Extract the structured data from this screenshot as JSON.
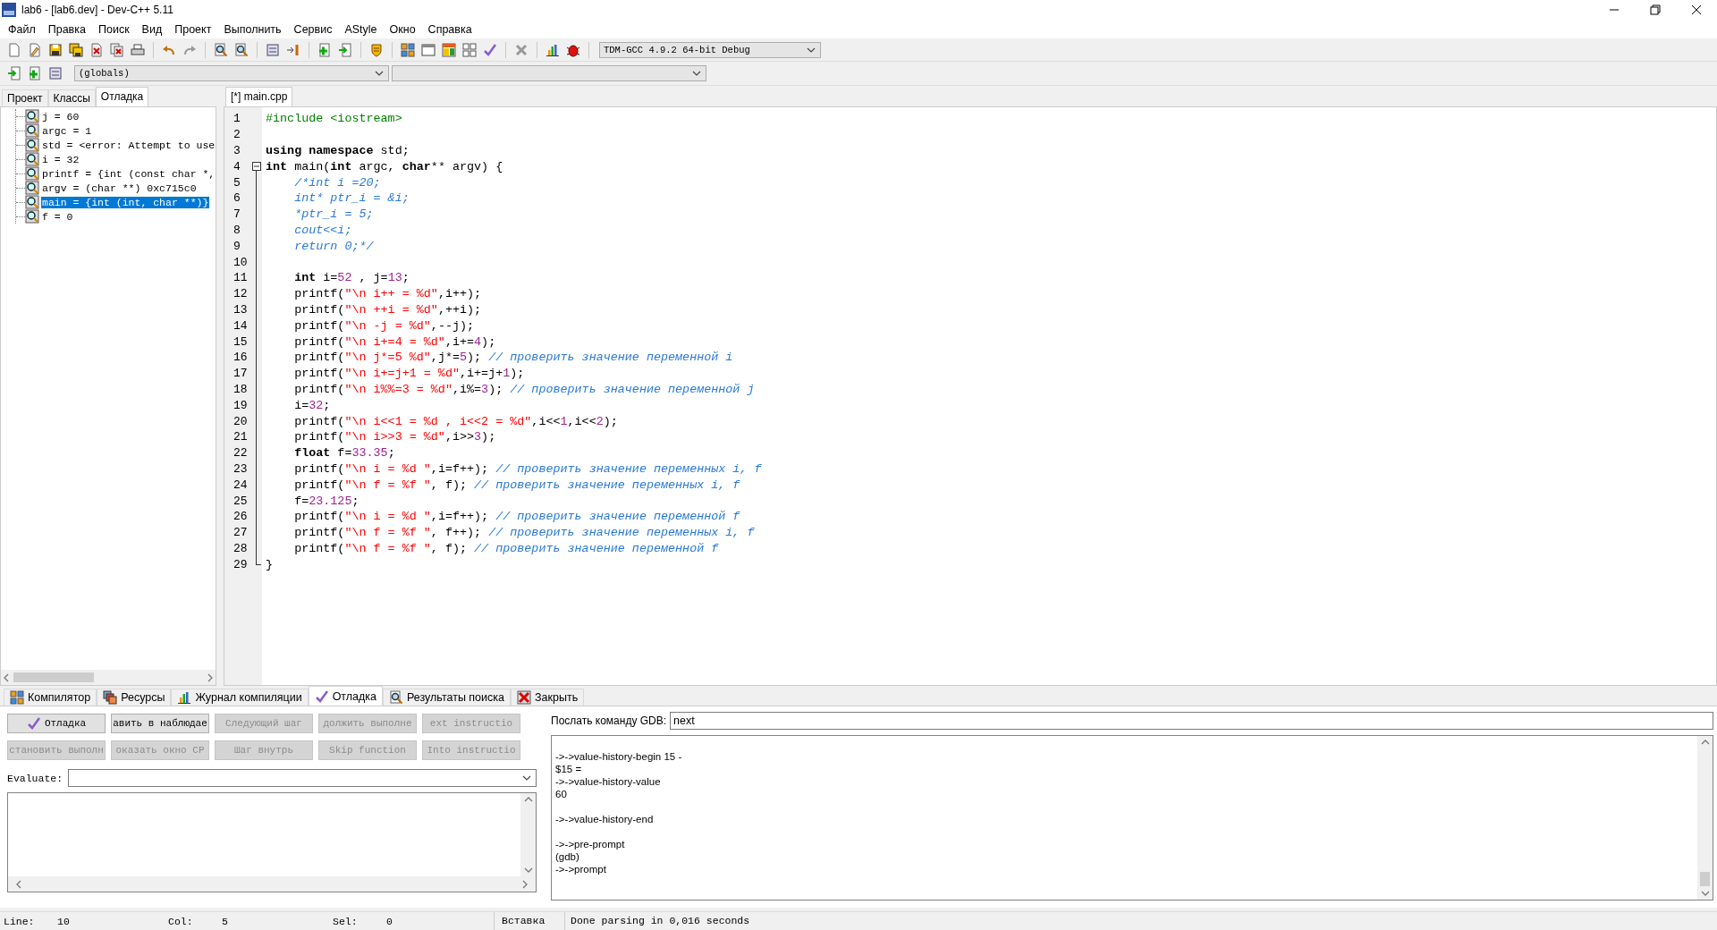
{
  "window": {
    "title": "lab6 - [lab6.dev] - Dev-C++ 5.11"
  },
  "menu": [
    "Файл",
    "Правка",
    "Поиск",
    "Вид",
    "Проект",
    "Выполнить",
    "Сервис",
    "AStyle",
    "Окно",
    "Справка"
  ],
  "toolbar": {
    "compiler": "TDM-GCC 4.9.2 64-bit Debug",
    "scope": "(globals)"
  },
  "left_panel": {
    "tabs": [
      {
        "label": "Проект",
        "selected": false
      },
      {
        "label": "Классы",
        "selected": false
      },
      {
        "label": "Отладка",
        "selected": true
      }
    ],
    "watches": [
      {
        "text": "j = 60",
        "selected": false
      },
      {
        "text": "argc = 1",
        "selected": false
      },
      {
        "text": "std = <error: Attempt to use",
        "selected": false
      },
      {
        "text": "i = 32",
        "selected": false
      },
      {
        "text": "printf = {int (const char *,",
        "selected": false
      },
      {
        "text": "argv = (char **) 0xc715c0",
        "selected": false
      },
      {
        "text": "main = {int (int, char **)}",
        "selected": true
      },
      {
        "text": "f = 0",
        "selected": false
      }
    ]
  },
  "editor": {
    "tabs": [
      {
        "label": "[*] main.cpp",
        "selected": true
      }
    ],
    "lines": [
      {
        "number": "1",
        "kind": "plain",
        "tokens": [
          {
            "kind": "pre",
            "text": "#include <iostream>"
          }
        ]
      },
      {
        "number": "2",
        "kind": "plain"
      },
      {
        "number": "3",
        "kind": "plain",
        "tokens": [
          {
            "kind": "kw",
            "text": "using namespace"
          },
          {
            "kind": "txt",
            "text": " std;"
          }
        ]
      },
      {
        "number": "4",
        "kind": "fold_start",
        "tokens": [
          {
            "kind": "kw",
            "text": "int"
          },
          {
            "kind": "txt",
            "text": " main("
          },
          {
            "kind": "kw",
            "text": "int"
          },
          {
            "kind": "txt",
            "text": " argc, "
          },
          {
            "kind": "kw",
            "text": "char"
          },
          {
            "kind": "txt",
            "text": "** argv) {"
          }
        ]
      },
      {
        "number": "5",
        "kind": "fold_body",
        "tokens": [
          {
            "kind": "com",
            "text": "    /*int i =20;"
          }
        ]
      },
      {
        "number": "6",
        "kind": "fold_body",
        "tokens": [
          {
            "kind": "com",
            "text": "    int* ptr_i = &i;"
          }
        ]
      },
      {
        "number": "7",
        "kind": "fold_body",
        "tokens": [
          {
            "kind": "com",
            "text": "    *ptr_i = 5;"
          }
        ]
      },
      {
        "number": "8",
        "kind": "fold_body",
        "tokens": [
          {
            "kind": "com",
            "text": "    cout<<i;"
          }
        ]
      },
      {
        "number": "9",
        "kind": "fold_body",
        "tokens": [
          {
            "kind": "com",
            "text": "    return 0;*/"
          }
        ]
      },
      {
        "number": "10",
        "kind": "fold_body"
      },
      {
        "number": "11",
        "kind": "fold_body",
        "tokens": [
          {
            "kind": "kw",
            "text": "    int"
          },
          {
            "kind": "txt",
            "text": " i="
          },
          {
            "kind": "num",
            "text": "52"
          },
          {
            "kind": "txt",
            "text": " , j="
          },
          {
            "kind": "num",
            "text": "13"
          },
          {
            "kind": "txt",
            "text": ";"
          }
        ]
      },
      {
        "number": "12",
        "kind": "fold_body",
        "tokens": [
          {
            "kind": "txt",
            "text": "    printf("
          },
          {
            "kind": "str",
            "text": "\"\\n i++ = %d\""
          },
          {
            "kind": "txt",
            "text": ",i++);"
          }
        ]
      },
      {
        "number": "13",
        "kind": "fold_body",
        "tokens": [
          {
            "kind": "txt",
            "text": "    printf("
          },
          {
            "kind": "str",
            "text": "\"\\n ++i = %d\""
          },
          {
            "kind": "txt",
            "text": ",++i);"
          }
        ]
      },
      {
        "number": "14",
        "kind": "fold_body",
        "tokens": [
          {
            "kind": "txt",
            "text": "    printf("
          },
          {
            "kind": "str",
            "text": "\"\\n -j = %d\""
          },
          {
            "kind": "txt",
            "text": ",--j);"
          }
        ]
      },
      {
        "number": "15",
        "kind": "fold_body",
        "tokens": [
          {
            "kind": "txt",
            "text": "    printf("
          },
          {
            "kind": "str",
            "text": "\"\\n i+=4 = %d\""
          },
          {
            "kind": "txt",
            "text": ",i+="
          },
          {
            "kind": "num",
            "text": "4"
          },
          {
            "kind": "txt",
            "text": ");"
          }
        ]
      },
      {
        "number": "16",
        "kind": "fold_body",
        "tokens": [
          {
            "kind": "txt",
            "text": "    printf("
          },
          {
            "kind": "str",
            "text": "\"\\n j*=5 %d\""
          },
          {
            "kind": "txt",
            "text": ",j*="
          },
          {
            "kind": "num",
            "text": "5"
          },
          {
            "kind": "txt",
            "text": "); "
          },
          {
            "kind": "com",
            "text": "// проверить значение переменной i"
          }
        ]
      },
      {
        "number": "17",
        "kind": "fold_body",
        "tokens": [
          {
            "kind": "txt",
            "text": "    printf("
          },
          {
            "kind": "str",
            "text": "\"\\n i+=j+1 = %d\""
          },
          {
            "kind": "txt",
            "text": ",i+=j+"
          },
          {
            "kind": "num",
            "text": "1"
          },
          {
            "kind": "txt",
            "text": ");"
          }
        ]
      },
      {
        "number": "18",
        "kind": "fold_body",
        "tokens": [
          {
            "kind": "txt",
            "text": "    printf("
          },
          {
            "kind": "str",
            "text": "\"\\n i%%=3 = %d\""
          },
          {
            "kind": "txt",
            "text": ",i%="
          },
          {
            "kind": "num",
            "text": "3"
          },
          {
            "kind": "txt",
            "text": "); "
          },
          {
            "kind": "com",
            "text": "// проверить значение переменной j"
          }
        ]
      },
      {
        "number": "19",
        "kind": "fold_body",
        "tokens": [
          {
            "kind": "txt",
            "text": "    i="
          },
          {
            "kind": "num",
            "text": "32"
          },
          {
            "kind": "txt",
            "text": ";"
          }
        ]
      },
      {
        "number": "20",
        "kind": "fold_body",
        "tokens": [
          {
            "kind": "txt",
            "text": "    printf("
          },
          {
            "kind": "str",
            "text": "\"\\n i<<1 = %d , i<<2 = %d\""
          },
          {
            "kind": "txt",
            "text": ",i<<"
          },
          {
            "kind": "num",
            "text": "1"
          },
          {
            "kind": "txt",
            "text": ",i<<"
          },
          {
            "kind": "num",
            "text": "2"
          },
          {
            "kind": "txt",
            "text": ");"
          }
        ]
      },
      {
        "number": "21",
        "kind": "fold_body",
        "tokens": [
          {
            "kind": "txt",
            "text": "    printf("
          },
          {
            "kind": "str",
            "text": "\"\\n i>>3 = %d\""
          },
          {
            "kind": "txt",
            "text": ",i>>"
          },
          {
            "kind": "num",
            "text": "3"
          },
          {
            "kind": "txt",
            "text": ");"
          }
        ]
      },
      {
        "number": "22",
        "kind": "fold_body",
        "tokens": [
          {
            "kind": "kw",
            "text": "    float"
          },
          {
            "kind": "txt",
            "text": " f="
          },
          {
            "kind": "num",
            "text": "33.35"
          },
          {
            "kind": "txt",
            "text": ";"
          }
        ]
      },
      {
        "number": "23",
        "kind": "fold_body",
        "tokens": [
          {
            "kind": "txt",
            "text": "    printf("
          },
          {
            "kind": "str",
            "text": "\"\\n i = %d \""
          },
          {
            "kind": "txt",
            "text": ",i=f++); "
          },
          {
            "kind": "com",
            "text": "// проверить значение переменных i, f"
          }
        ]
      },
      {
        "number": "24",
        "kind": "fold_body",
        "tokens": [
          {
            "kind": "txt",
            "text": "    printf("
          },
          {
            "kind": "str",
            "text": "\"\\n f = %f \""
          },
          {
            "kind": "txt",
            "text": ", f); "
          },
          {
            "kind": "com",
            "text": "// проверить значение переменных i, f"
          }
        ]
      },
      {
        "number": "25",
        "kind": "fold_body",
        "tokens": [
          {
            "kind": "txt",
            "text": "    f="
          },
          {
            "kind": "num",
            "text": "23.125"
          },
          {
            "kind": "txt",
            "text": ";"
          }
        ]
      },
      {
        "number": "26",
        "kind": "fold_body",
        "tokens": [
          {
            "kind": "txt",
            "text": "    printf("
          },
          {
            "kind": "str",
            "text": "\"\\n i = %d \""
          },
          {
            "kind": "txt",
            "text": ",i=f++); "
          },
          {
            "kind": "com",
            "text": "// проверить значение переменной f"
          }
        ]
      },
      {
        "number": "27",
        "kind": "fold_body",
        "tokens": [
          {
            "kind": "txt",
            "text": "    printf("
          },
          {
            "kind": "str",
            "text": "\"\\n f = %f \""
          },
          {
            "kind": "txt",
            "text": ", f++); "
          },
          {
            "kind": "com",
            "text": "// проверить значение переменных i, f"
          }
        ]
      },
      {
        "number": "28",
        "kind": "fold_body",
        "tokens": [
          {
            "kind": "txt",
            "text": "    printf("
          },
          {
            "kind": "str",
            "text": "\"\\n f = %f \""
          },
          {
            "kind": "txt",
            "text": ", f); "
          },
          {
            "kind": "com",
            "text": "// проверить значение переменной f"
          }
        ]
      },
      {
        "number": "29",
        "kind": "fold_end",
        "tokens": [
          {
            "kind": "txt",
            "text": "}"
          }
        ]
      }
    ]
  },
  "bottom_panel": {
    "tabs": [
      {
        "label": "Компилятор",
        "kind": "compiler",
        "selected": false
      },
      {
        "label": "Ресурсы",
        "kind": "resources",
        "selected": false
      },
      {
        "label": "Журнал компиляции",
        "kind": "log",
        "selected": false
      },
      {
        "label": "Отладка",
        "kind": "debug",
        "selected": true
      },
      {
        "label": "Результаты поиска",
        "kind": "search",
        "selected": false
      },
      {
        "label": "Закрыть",
        "kind": "close",
        "selected": false
      }
    ],
    "debug": {
      "buttons": [
        {
          "label": "Отладка",
          "kind": "start",
          "disabled": false
        },
        {
          "label": "авить в наблюдае",
          "kind": "plain",
          "disabled": false
        },
        {
          "label": "Следующий шаг",
          "kind": "plain",
          "disabled": true
        },
        {
          "label": "должить выполне",
          "kind": "plain",
          "disabled": true
        },
        {
          "label": "ext instructio",
          "kind": "plain",
          "disabled": true
        },
        {
          "label": "становить выполн",
          "kind": "plain",
          "disabled": true
        },
        {
          "label": "оказать окно CP",
          "kind": "plain",
          "disabled": true
        },
        {
          "label": "Шаг внутрь",
          "kind": "plain",
          "disabled": true
        },
        {
          "label": "Skip function",
          "kind": "plain",
          "disabled": true
        },
        {
          "label": "Into instructio",
          "kind": "plain",
          "disabled": true
        }
      ],
      "evaluate_label": "Evaluate:",
      "gdb_label": "Послать команду GDB:",
      "gdb_command": "next",
      "output": [
        [
          "->->value-history-begin 15 -",
          "$15 =",
          "->->value-history-value",
          "60"
        ],
        [
          "->->value-history-end"
        ],
        [
          "->->pre-prompt",
          "(gdb)",
          "->->prompt"
        ]
      ]
    }
  },
  "status_bar": {
    "fields": [
      {
        "label": "Line:",
        "value": "10"
      },
      {
        "label": "Col:",
        "value": "5"
      },
      {
        "label": "Sel:",
        "value": "0"
      }
    ],
    "mode": "Вставка",
    "message": "Done parsing in 0,016 seconds"
  }
}
